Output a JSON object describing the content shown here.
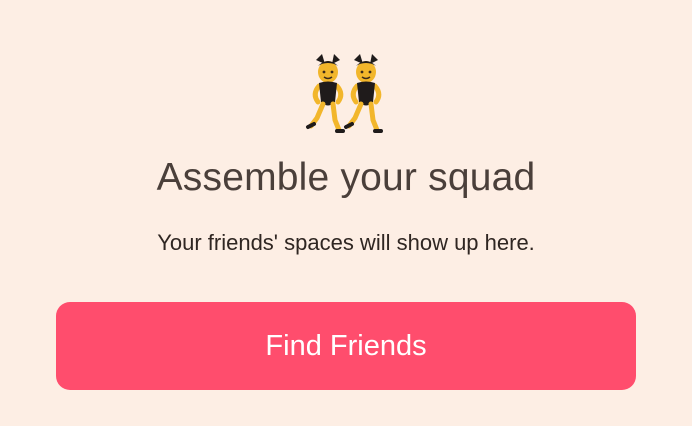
{
  "empty_state": {
    "illustration_icon": "people-with-bunny-ears-icon",
    "title": "Assemble your squad",
    "subtitle": "Your friends' spaces will show up here.",
    "button_label": "Find Friends"
  },
  "colors": {
    "background": "#fdeee4",
    "button": "#ff4d6d",
    "button_text": "#ffffff",
    "title_text": "#4a3f3a",
    "subtitle_text": "#2f2622",
    "figure_skin": "#f2b62b",
    "figure_outfit": "#1f1b1b"
  }
}
